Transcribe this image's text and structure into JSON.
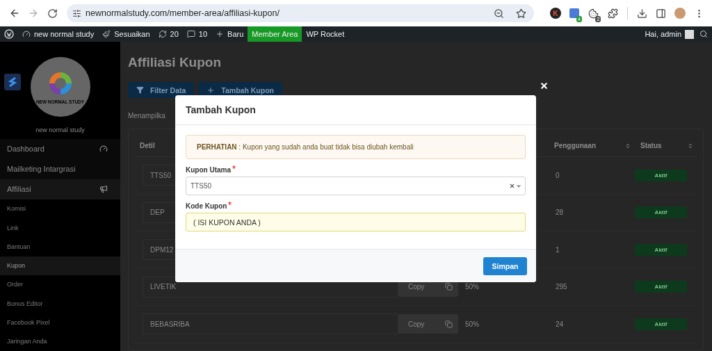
{
  "browser": {
    "url": "newnormalstudy.com/member-area/affiliasi-kupon/",
    "extensions": [
      {
        "kind": "letter",
        "label": "K"
      },
      {
        "kind": "tile",
        "badge": "4"
      },
      {
        "kind": "cookie",
        "badge": "2"
      },
      {
        "kind": "puzzle"
      }
    ]
  },
  "admin_bar": {
    "items": [
      {
        "label": "new normal study",
        "selected": false
      },
      {
        "label": "Sesuaikan",
        "selected": false
      },
      {
        "label": "20",
        "selected": false
      },
      {
        "label": "10",
        "selected": false
      },
      {
        "label": "Baru",
        "selected": false
      },
      {
        "label": "Member Area",
        "selected": true
      },
      {
        "label": "WP Rocket",
        "selected": false
      }
    ],
    "greeting": "Hai, admin"
  },
  "sidebar": {
    "brand_caption": "new normal study",
    "logo_text": "NEW NORMAL STUDY",
    "menu": [
      {
        "label": "Dashboard",
        "selected": false,
        "expanded": false
      },
      {
        "label": "Mailketing Intargrasi",
        "selected": false,
        "expanded": false
      },
      {
        "label": "Affiliasi",
        "selected": false,
        "expanded": true,
        "children": [
          {
            "label": "Komisi",
            "selected": false
          },
          {
            "label": "Link",
            "selected": false
          },
          {
            "label": "Bantuan",
            "selected": false
          },
          {
            "label": "Kupon",
            "selected": true
          },
          {
            "label": "Order",
            "selected": false
          },
          {
            "label": "Bonus Editor",
            "selected": false
          },
          {
            "label": "Facebook Pixel",
            "selected": false
          },
          {
            "label": "Jaringan Anda",
            "selected": false
          }
        ]
      }
    ]
  },
  "page": {
    "title": "Affiliasi Kupon",
    "buttons": [
      {
        "label": "Filter Data"
      },
      {
        "label": "Tambah Kupon"
      }
    ],
    "info": "Menampilka",
    "table": {
      "columns": [
        {
          "label": "Detil",
          "sortable": false
        },
        {
          "label": "Penggunaan",
          "sortable": true
        },
        {
          "label": "Status",
          "sortable": true
        }
      ],
      "rows": [
        {
          "detil": "TTS50",
          "usage": "0",
          "status": "Aktif"
        },
        {
          "detil": "DEP",
          "usage": "28",
          "status": "Aktif"
        },
        {
          "detil": "DPM12",
          "usage": "1",
          "status": "Aktif"
        },
        {
          "detil": "LIVETIK",
          "copy": "Copy",
          "column_3": "50%",
          "usage": "295",
          "status": "Aktif"
        },
        {
          "detil": "BEBASRIBA",
          "copy": "Copy",
          "column_3": "50%",
          "usage": "24",
          "status": "Aktif"
        }
      ]
    }
  },
  "modal": {
    "title": "Tambah Kupon",
    "alert": "**PERHATIAN** : Kupon yang sudah anda buat tidak bisa diubah kembali",
    "fields": [
      {
        "kind": "select",
        "label": "Kupon Utama",
        "required": true,
        "value": "TTS50"
      },
      {
        "kind": "text",
        "label": "Kode Kupon",
        "required": true,
        "value": "( ISI KUPON ANDA )"
      }
    ],
    "submit": "Simpan"
  }
}
